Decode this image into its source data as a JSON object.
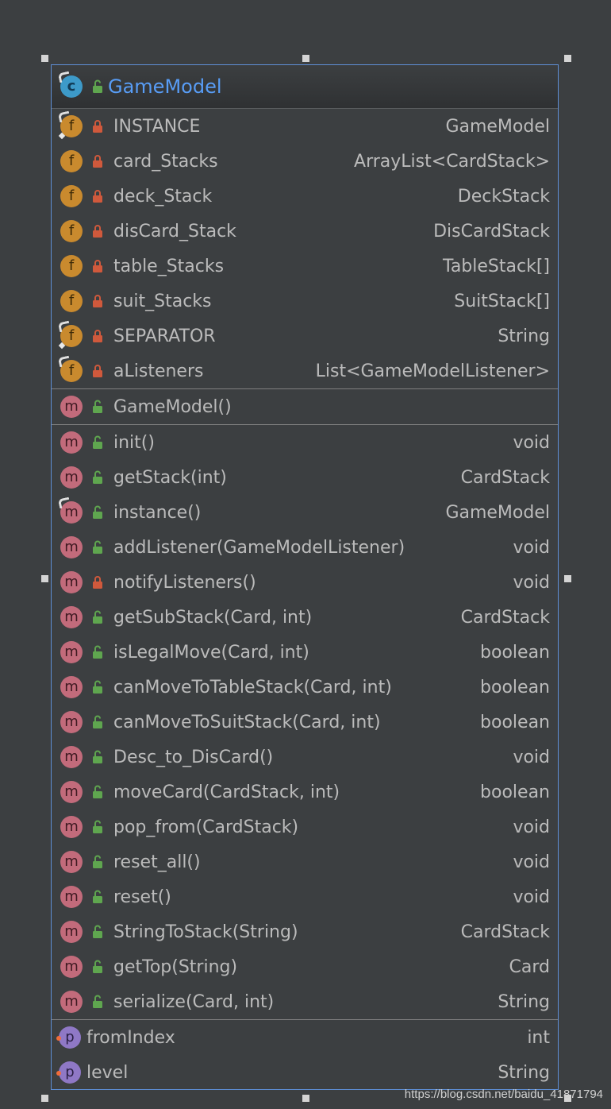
{
  "class": {
    "name": "GameModel",
    "icon": "class-c-icon",
    "visibility": "public"
  },
  "fields": [
    {
      "name": "INSTANCE",
      "type": "GameModel",
      "icon": "field-f-icon",
      "static": true,
      "final": true,
      "visibility": "private"
    },
    {
      "name": "card_Stacks",
      "type": "ArrayList<CardStack>",
      "icon": "field-f-icon",
      "static": false,
      "final": false,
      "visibility": "private"
    },
    {
      "name": "deck_Stack",
      "type": "DeckStack",
      "icon": "field-f-icon",
      "static": false,
      "final": false,
      "visibility": "private"
    },
    {
      "name": "disCard_Stack",
      "type": "DisCardStack",
      "icon": "field-f-icon",
      "static": false,
      "final": false,
      "visibility": "private"
    },
    {
      "name": "table_Stacks",
      "type": "TableStack[]",
      "icon": "field-f-icon",
      "static": false,
      "final": false,
      "visibility": "private"
    },
    {
      "name": "suit_Stacks",
      "type": "SuitStack[]",
      "icon": "field-f-icon",
      "static": false,
      "final": false,
      "visibility": "private"
    },
    {
      "name": "SEPARATOR",
      "type": "String",
      "icon": "field-f-icon",
      "static": true,
      "final": true,
      "visibility": "private"
    },
    {
      "name": "aListeners",
      "type": "List<GameModelListener>",
      "icon": "field-f-icon",
      "static": true,
      "final": false,
      "visibility": "private"
    }
  ],
  "constructors": [
    {
      "name": "GameModel()",
      "type": "",
      "icon": "method-m-icon",
      "static": false,
      "final": false,
      "visibility": "public"
    }
  ],
  "methods": [
    {
      "name": "init()",
      "type": "void",
      "icon": "method-m-icon",
      "static": false,
      "final": false,
      "visibility": "public"
    },
    {
      "name": "getStack(int)",
      "type": "CardStack",
      "icon": "method-m-icon",
      "static": false,
      "final": false,
      "visibility": "public"
    },
    {
      "name": "instance()",
      "type": "GameModel",
      "icon": "method-m-icon",
      "static": true,
      "final": false,
      "visibility": "public"
    },
    {
      "name": "addListener(GameModelListener)",
      "type": "void",
      "icon": "method-m-icon",
      "static": false,
      "final": false,
      "visibility": "public"
    },
    {
      "name": "notifyListeners()",
      "type": "void",
      "icon": "method-m-icon",
      "static": false,
      "final": false,
      "visibility": "private"
    },
    {
      "name": "getSubStack(Card, int)",
      "type": "CardStack",
      "icon": "method-m-icon",
      "static": false,
      "final": false,
      "visibility": "public"
    },
    {
      "name": "isLegalMove(Card, int)",
      "type": "boolean",
      "icon": "method-m-icon",
      "static": false,
      "final": false,
      "visibility": "public"
    },
    {
      "name": "canMoveToTableStack(Card, int)",
      "type": "boolean",
      "icon": "method-m-icon",
      "static": false,
      "final": false,
      "visibility": "public"
    },
    {
      "name": "canMoveToSuitStack(Card, int)",
      "type": "boolean",
      "icon": "method-m-icon",
      "static": false,
      "final": false,
      "visibility": "public"
    },
    {
      "name": "Desc_to_DisCard()",
      "type": "void",
      "icon": "method-m-icon",
      "static": false,
      "final": false,
      "visibility": "public"
    },
    {
      "name": "moveCard(CardStack, int)",
      "type": "boolean",
      "icon": "method-m-icon",
      "static": false,
      "final": false,
      "visibility": "public"
    },
    {
      "name": "pop_from(CardStack)",
      "type": "void",
      "icon": "method-m-icon",
      "static": false,
      "final": false,
      "visibility": "public"
    },
    {
      "name": "reset_all()",
      "type": "void",
      "icon": "method-m-icon",
      "static": false,
      "final": false,
      "visibility": "public"
    },
    {
      "name": "reset()",
      "type": "void",
      "icon": "method-m-icon",
      "static": false,
      "final": false,
      "visibility": "public"
    },
    {
      "name": "StringToStack(String)",
      "type": "CardStack",
      "icon": "method-m-icon",
      "static": false,
      "final": false,
      "visibility": "public"
    },
    {
      "name": "getTop(String)",
      "type": "Card",
      "icon": "method-m-icon",
      "static": false,
      "final": false,
      "visibility": "public"
    },
    {
      "name": "serialize(Card, int)",
      "type": "String",
      "icon": "method-m-icon",
      "static": false,
      "final": false,
      "visibility": "public"
    }
  ],
  "properties": [
    {
      "name": "fromIndex",
      "type": "int",
      "icon": "property-p-icon"
    },
    {
      "name": "level",
      "type": "String",
      "icon": "property-p-icon"
    }
  ],
  "watermark": "https://blog.csdn.net/baidu_41871794",
  "colors": {
    "background": "#3c3f41",
    "border": "#5e8fd6",
    "title": "#589df6",
    "text": "#bbbbbb",
    "class_icon": "#3d9ac9",
    "field_icon": "#c98a2e",
    "method_icon": "#c26b7b",
    "property_icon": "#8f78c6",
    "public_lock": "#5fa64f",
    "private_lock": "#d0593c"
  }
}
